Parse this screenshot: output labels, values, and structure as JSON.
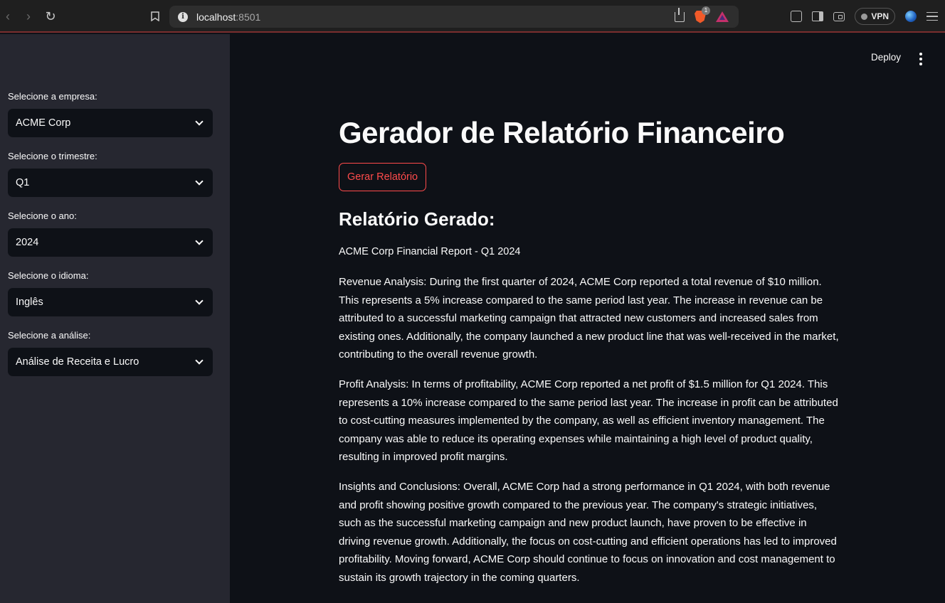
{
  "browser": {
    "url_host": "localhost",
    "url_port": ":8501",
    "brave_badge": "1",
    "vpn_label": "VPN"
  },
  "header": {
    "deploy_label": "Deploy"
  },
  "sidebar": {
    "fields": [
      {
        "label": "Selecione a empresa:",
        "value": "ACME Corp"
      },
      {
        "label": "Selecione o trimestre:",
        "value": "Q1"
      },
      {
        "label": "Selecione o ano:",
        "value": "2024"
      },
      {
        "label": "Selecione o idioma:",
        "value": "Inglês"
      },
      {
        "label": "Selecione a análise:",
        "value": "Análise de Receita e Lucro"
      }
    ]
  },
  "main": {
    "title": "Gerador de Relatório Financeiro",
    "generate_button": "Gerar Relatório",
    "report_heading": "Relatório Gerado:",
    "report_title": "ACME Corp Financial Report - Q1 2024",
    "paragraphs": [
      "Revenue Analysis: During the first quarter of 2024, ACME Corp reported a total revenue of $10 million. This represents a 5% increase compared to the same period last year. The increase in revenue can be attributed to a successful marketing campaign that attracted new customers and increased sales from existing ones. Additionally, the company launched a new product line that was well-received in the market, contributing to the overall revenue growth.",
      "Profit Analysis: In terms of profitability, ACME Corp reported a net profit of $1.5 million for Q1 2024. This represents a 10% increase compared to the same period last year. The increase in profit can be attributed to cost-cutting measures implemented by the company, as well as efficient inventory management. The company was able to reduce its operating expenses while maintaining a high level of product quality, resulting in improved profit margins.",
      "Insights and Conclusions: Overall, ACME Corp had a strong performance in Q1 2024, with both revenue and profit showing positive growth compared to the previous year. The company's strategic initiatives, such as the successful marketing campaign and new product launch, have proven to be effective in driving revenue growth. Additionally, the focus on cost-cutting and efficient operations has led to improved profitability. Moving forward, ACME Corp should continue to focus on innovation and cost management to sustain its growth trajectory in the coming quarters."
    ]
  }
}
